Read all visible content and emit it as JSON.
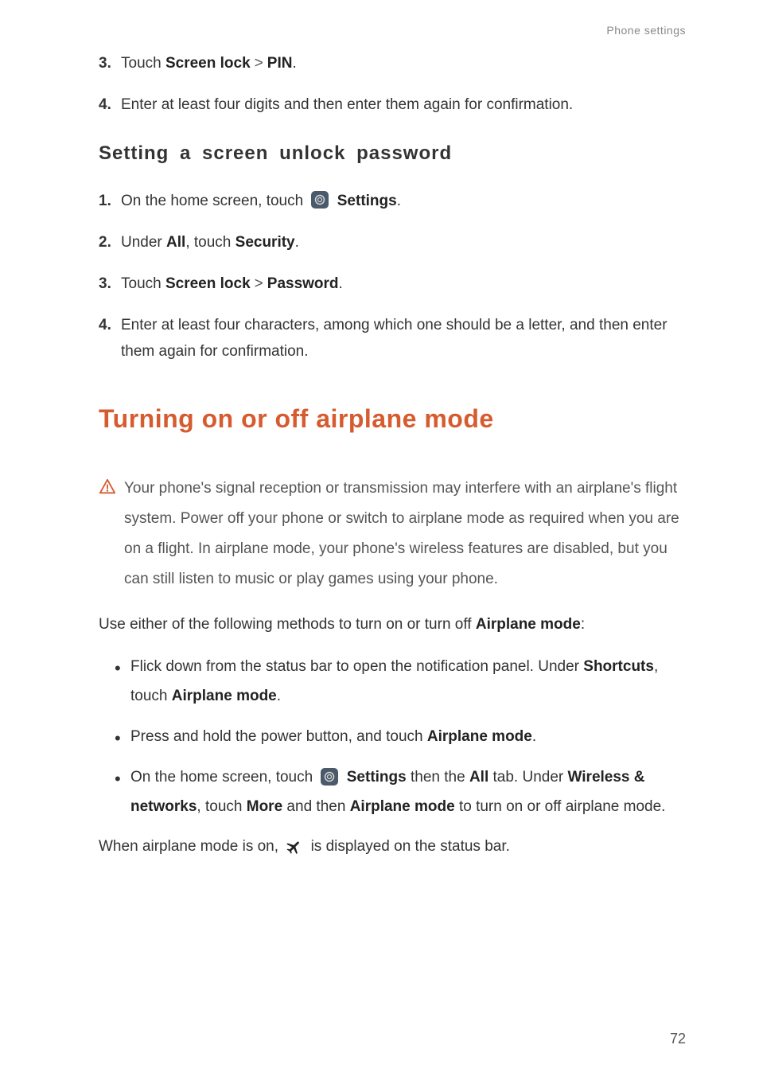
{
  "breadcrumb": "Phone settings",
  "pin_steps": {
    "s3": {
      "num": "3.",
      "pre": "Touch ",
      "link1": "Screen lock",
      "sep": ">",
      "link2": "PIN",
      "post": "."
    },
    "s4": {
      "num": "4.",
      "text": "Enter at least four digits and then enter them again for confirmation."
    }
  },
  "subheading": "Setting a screen unlock password",
  "pw_steps": {
    "s1": {
      "num": "1.",
      "pre": "On the home screen, touch ",
      "bold": "Settings",
      "post": "."
    },
    "s2": {
      "num": "2.",
      "pre": "Under ",
      "b1": "All",
      "mid": ", touch ",
      "b2": "Security",
      "post": "."
    },
    "s3": {
      "num": "3.",
      "pre": "Touch ",
      "link1": "Screen lock",
      "sep": ">",
      "link2": "Password",
      "post": "."
    },
    "s4": {
      "num": "4.",
      "text": "Enter at least four characters, among which one should be a letter, and then enter them again for confirmation."
    }
  },
  "section_title": "Turning on or off airplane mode",
  "warning_text": "Your phone's signal reception or transmission may interfere with an airplane's flight system. Power off your phone or switch to airplane mode as required when you are on a flight. In airplane mode, your phone's wireless features are disabled, but you can still listen to music or play games using your phone.",
  "intro_para": {
    "pre": "Use either of the following methods to turn on or turn off ",
    "b": "Airplane mode",
    "post": ":"
  },
  "bullets": {
    "b1": {
      "pre": "Flick down from the status bar to open the notification panel. Under ",
      "b1": "Shortcuts",
      "mid": ", touch ",
      "b2": "Airplane mode",
      "post": "."
    },
    "b2": {
      "pre": "Press and hold the power button, and touch ",
      "b": "Airplane mode",
      "post": "."
    },
    "b3": {
      "pre": "On the home screen, touch ",
      "b1": "Settings",
      "mid1": " then the ",
      "b2": "All",
      "mid2": " tab. Under ",
      "b3": "Wireless & networks",
      "mid3": ", touch ",
      "b4": "More",
      "mid4": " and then ",
      "b5": "Airplane mode",
      "post": " to turn on or off airplane mode."
    }
  },
  "closing": {
    "pre": "When airplane mode is on, ",
    "post": " is displayed on the status bar."
  },
  "page_number": "72"
}
